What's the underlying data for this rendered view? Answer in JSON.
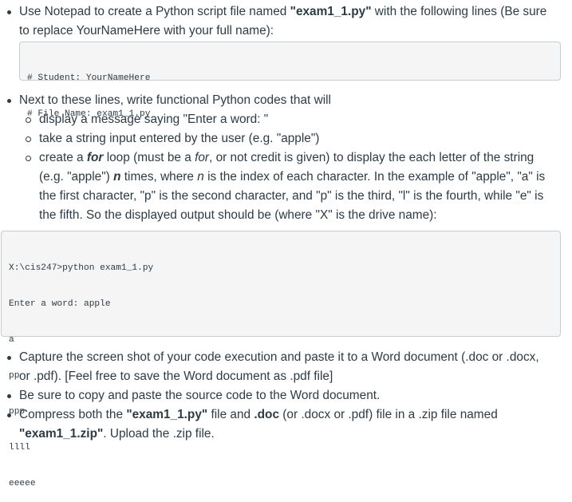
{
  "bullet1": {
    "pre": "Use Notepad to create a Python script file named ",
    "filename": "\"exam1_1.py\"",
    "post": " with the following lines (Be sure",
    "line2": "to replace YourNameHere with your full name):"
  },
  "code_header": [
    "# Student: YourNameHere",
    "# File Name: exam1_1.py"
  ],
  "bullet2": {
    "text": "Next to these lines, write functional Python codes that will",
    "sub1": "display a message saying \"Enter a word: \"",
    "sub2": "take a string input entered by the user (e.g. \"apple\")",
    "sub3": {
      "l1_pre": "create a ",
      "l1_for": "for",
      "l1_post": " loop (must be a ",
      "l1_for2": "for",
      "l1_end": ", or not credit is given) to display the each letter of the string",
      "l2_pre": "(e.g. \"apple\") ",
      "l2_n": "n",
      "l2_mid": " times, where ",
      "l2_n2": "n",
      "l2_end": " is the index of each character. In the example of \"apple\", \"a\" is",
      "l3": "the first character, \"p\" is the second character, and \"p\" is the third, \"l\" is the fourth, while \"e\" is",
      "l4": "the fifth. So the displayed output should be (where \"X\" is the drive name):"
    }
  },
  "code_output": [
    "X:\\cis247>python exam1_1.py",
    "Enter a word: apple",
    "a",
    "pp",
    "ppp",
    "llll",
    "eeeee"
  ],
  "bullet3": {
    "l1": "Capture the screen shot of your code execution and paste it to a Word document (.doc or .docx,",
    "l2": "or .pdf). [Feel free to save the Word document as .pdf file]"
  },
  "bullet4": "Be sure to copy and paste the source code to the Word document.",
  "bullet5": {
    "l1_pre": "Compress both the ",
    "l1_file": "\"exam1_1.py\"",
    "l1_mid": " file and ",
    "l1_doc": ".doc",
    "l1_end": " (or .docx or .pdf) file in a .zip file named",
    "l2_file": "\"exam1_1.zip\"",
    "l2_end": ". Upload the .zip file."
  }
}
